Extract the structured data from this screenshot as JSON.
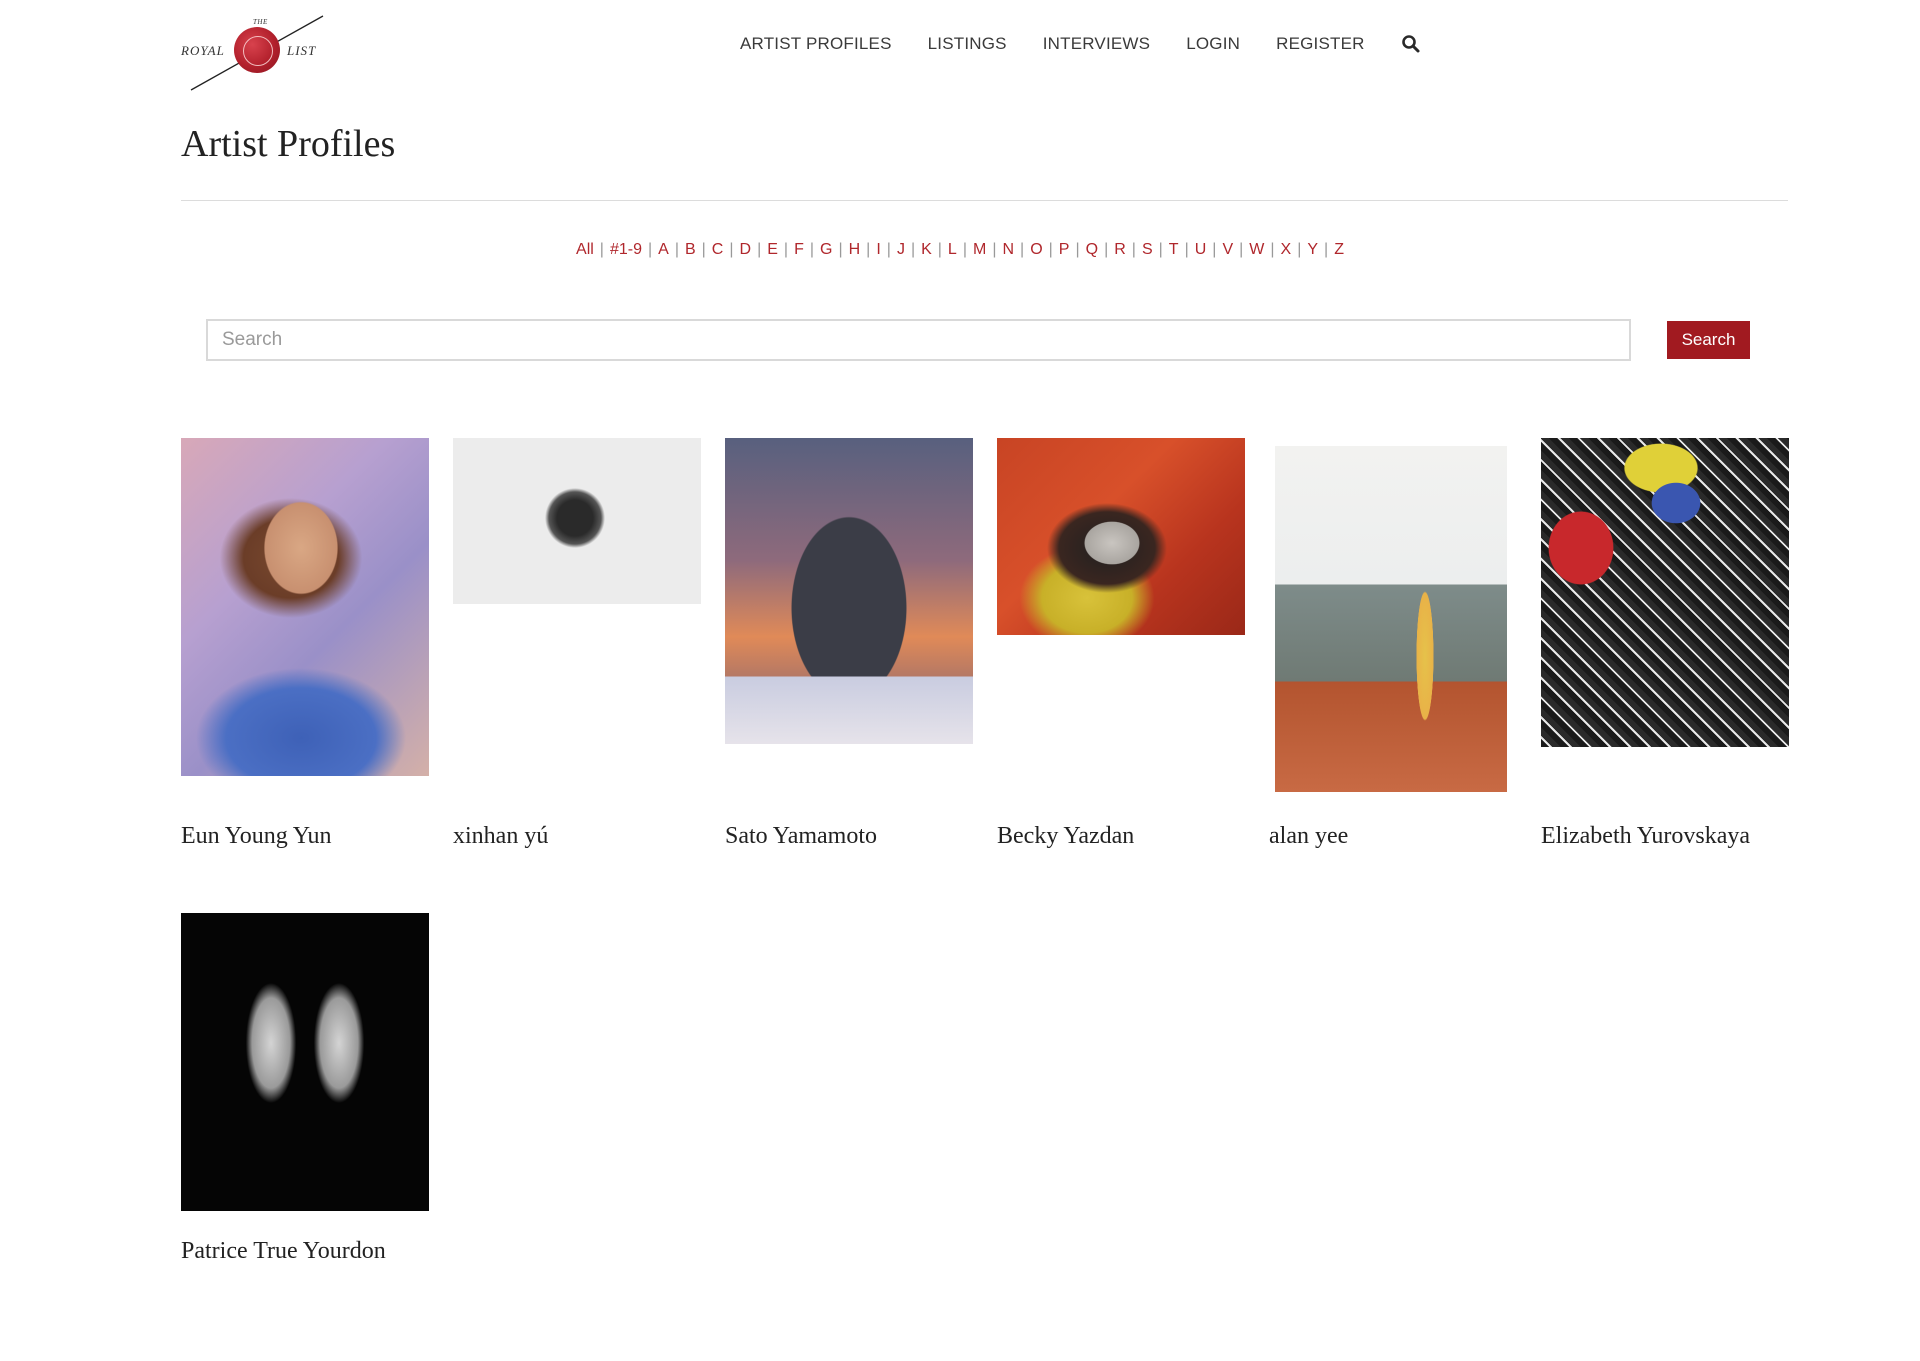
{
  "logo": {
    "the": "THE",
    "royal": "ROYAL",
    "list": "LIST"
  },
  "nav": {
    "items": [
      {
        "label": "ARTIST PROFILES"
      },
      {
        "label": "LISTINGS"
      },
      {
        "label": "INTERVIEWS"
      },
      {
        "label": "LOGIN"
      },
      {
        "label": "REGISTER"
      }
    ],
    "search_icon": "search-icon"
  },
  "page": {
    "title": "Artist Profiles"
  },
  "alphabet": [
    "All",
    "#1-9",
    "A",
    "B",
    "C",
    "D",
    "E",
    "F",
    "G",
    "H",
    "I",
    "J",
    "K",
    "L",
    "M",
    "N",
    "O",
    "P",
    "Q",
    "R",
    "S",
    "T",
    "U",
    "V",
    "W",
    "X",
    "Y",
    "Z"
  ],
  "search": {
    "placeholder": "Search",
    "button_label": "Search"
  },
  "colors": {
    "accent": "#b0272c",
    "button": "#a11a20"
  },
  "artists": [
    {
      "name": "Eun Young Yun"
    },
    {
      "name": "xinhan yú"
    },
    {
      "name": "Sato Yamamoto"
    },
    {
      "name": "Becky Yazdan"
    },
    {
      "name": "alan yee"
    },
    {
      "name": "Elizabeth Yurovskaya"
    },
    {
      "name": "Patrice True Yourdon"
    }
  ]
}
